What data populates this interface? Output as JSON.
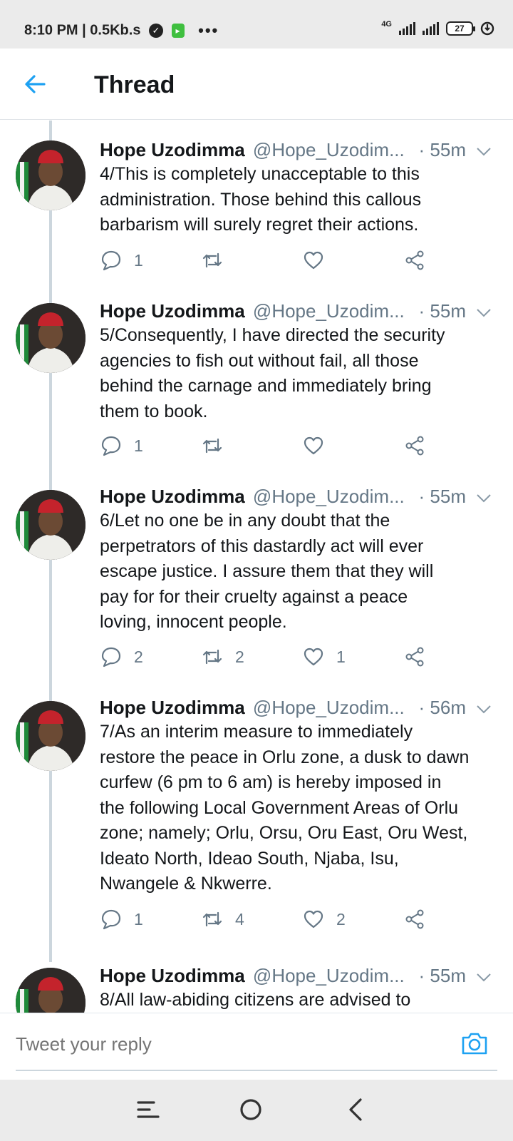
{
  "status_bar": {
    "time_text": "8:10 PM | 0.5Kb.s",
    "more_dots": "•••",
    "network_label": "4G",
    "battery_level": "27"
  },
  "header": {
    "title": "Thread"
  },
  "tweets": [
    {
      "author": "Hope Uzodimma",
      "handle": "@Hope_Uzodim...",
      "time": "· 55m",
      "lines": [
        "4/This is completely unacceptable to this",
        "administration. Those behind this callous",
        "barbarism will surely regret their actions."
      ],
      "reply_count": "1",
      "retweet_count": "",
      "like_count": ""
    },
    {
      "author": "Hope Uzodimma",
      "handle": "@Hope_Uzodim...",
      "time": "· 55m",
      "lines": [
        "5/Consequently, I have directed the security",
        "agencies to fish out without fail, all those",
        "behind the carnage and immediately bring",
        "them to book."
      ],
      "reply_count": "1",
      "retweet_count": "",
      "like_count": ""
    },
    {
      "author": "Hope Uzodimma",
      "handle": "@Hope_Uzodim...",
      "time": "· 55m",
      "lines": [
        "6/Let  no one be in any doubt that the",
        "perpetrators  of this dastardly act will ever",
        "escape justice. I assure them that they will",
        "pay for for their cruelty against a  peace",
        "loving, innocent people."
      ],
      "reply_count": "2",
      "retweet_count": "2",
      "like_count": "1"
    },
    {
      "author": "Hope Uzodimma",
      "handle": "@Hope_Uzodim...",
      "time": "· 56m",
      "lines": [
        "7/As an interim measure to immediately",
        "restore the peace in Orlu zone, a dusk to dawn",
        "curfew (6 pm to 6 am) is hereby imposed in",
        "the following Local Government Areas of Orlu",
        "zone; namely; Orlu, Orsu, Oru East, Oru West,",
        "Ideato North, Ideao South, Njaba, Isu,",
        "Nwangele & Nkwerre."
      ],
      "reply_count": "1",
      "retweet_count": "4",
      "like_count": "2"
    },
    {
      "author": "Hope Uzodimma",
      "handle": "@Hope_Uzodim...",
      "time": "· 55m",
      "lines": [
        "8/All law-abiding citizens are advised to"
      ],
      "reply_count": "",
      "retweet_count": "",
      "like_count": ""
    }
  ],
  "reply_bar": {
    "placeholder": "Tweet your reply"
  },
  "icons": {
    "back": "arrow-left-icon",
    "caret": "chevron-down-icon",
    "reply": "speech-bubble-icon",
    "retweet": "retweet-icon",
    "like": "heart-icon",
    "share": "share-icon",
    "camera": "camera-icon",
    "nav_menu": "menu-lines-icon",
    "nav_home": "circle-home-icon",
    "nav_back": "chevron-left-icon"
  },
  "colors": {
    "accent": "#1da1f2",
    "secondary_text": "#657786",
    "primary_text": "#14171a",
    "thread_line": "#ccd6dd",
    "system_bar": "#ebebeb"
  }
}
